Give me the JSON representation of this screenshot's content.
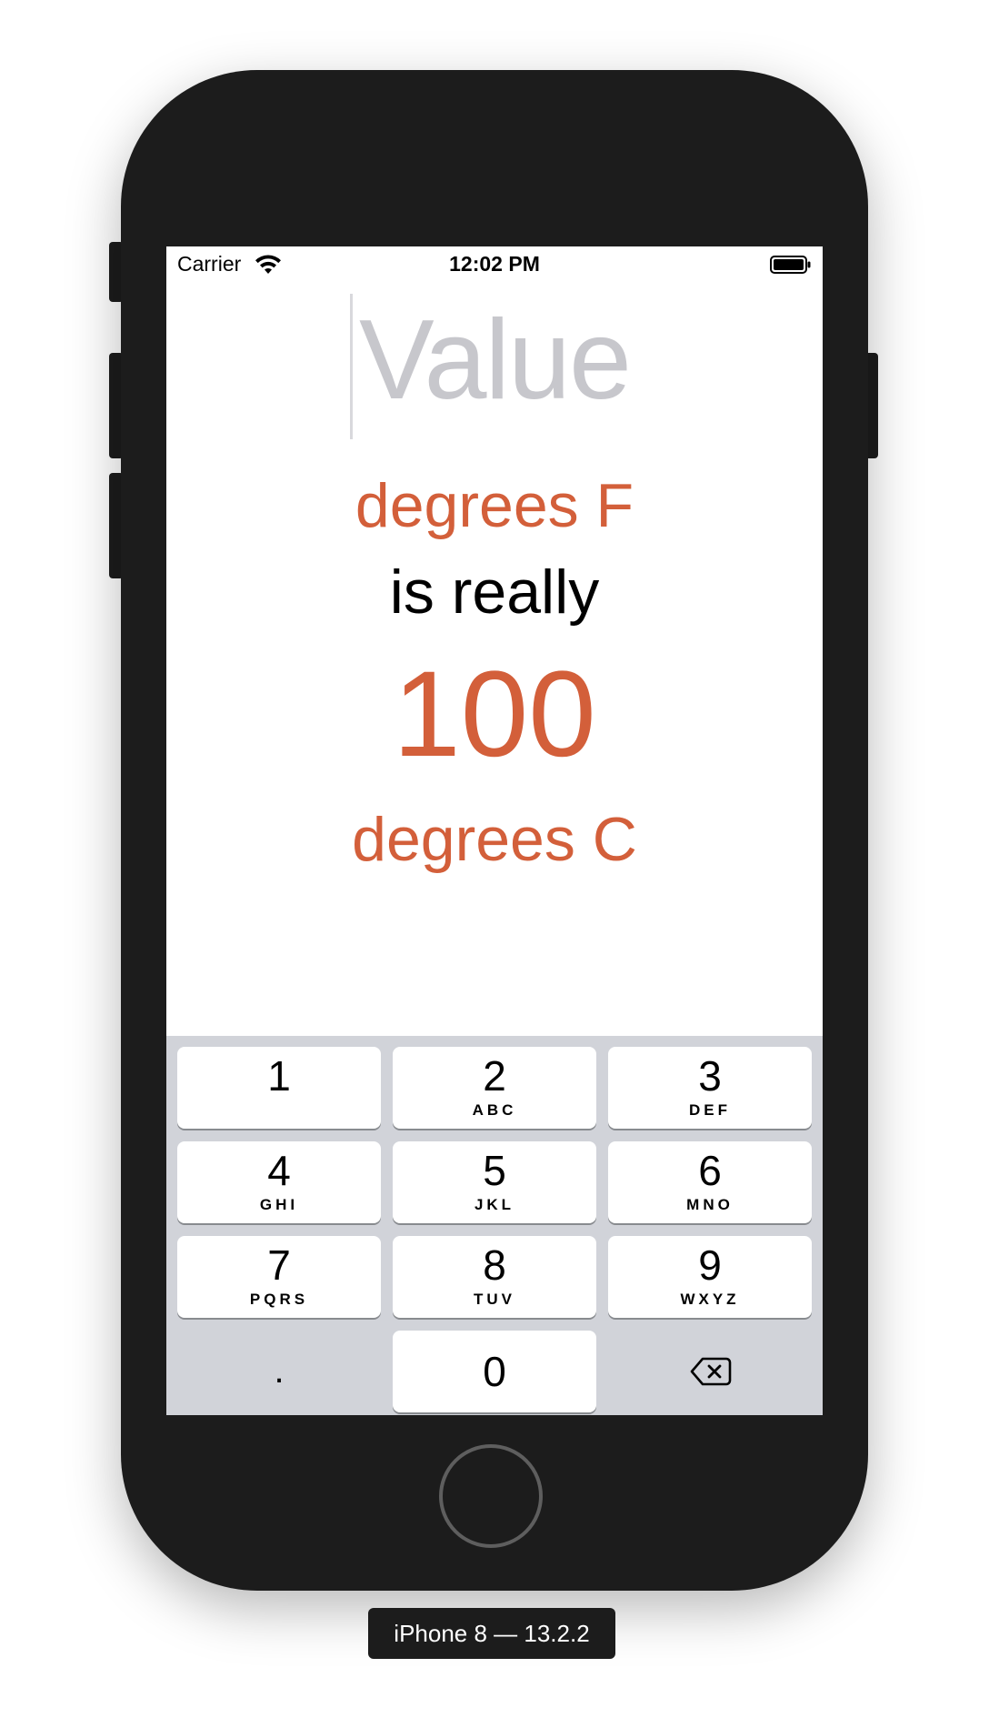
{
  "status_bar": {
    "carrier": "Carrier",
    "time": "12:02 PM"
  },
  "main": {
    "value_placeholder": "Value",
    "unit_from": "degrees F",
    "connector": "is really",
    "result": "100",
    "unit_to": "degrees C"
  },
  "keypad": {
    "keys": [
      {
        "digit": "1",
        "letters": ""
      },
      {
        "digit": "2",
        "letters": "ABC"
      },
      {
        "digit": "3",
        "letters": "DEF"
      },
      {
        "digit": "4",
        "letters": "GHI"
      },
      {
        "digit": "5",
        "letters": "JKL"
      },
      {
        "digit": "6",
        "letters": "MNO"
      },
      {
        "digit": "7",
        "letters": "PQRS"
      },
      {
        "digit": "8",
        "letters": "TUV"
      },
      {
        "digit": "9",
        "letters": "WXYZ"
      }
    ],
    "decimal": ".",
    "zero": "0",
    "backspace_icon": "backspace-icon"
  },
  "device_label": "iPhone 8 — 13.2.2",
  "colors": {
    "accent": "#d35f3a",
    "placeholder": "#c7c7cc",
    "keypad_bg": "#d1d3d9",
    "device_body": "#1c1c1c"
  },
  "icons": [
    "wifi-icon",
    "battery-icon",
    "backspace-icon",
    "home-button"
  ]
}
